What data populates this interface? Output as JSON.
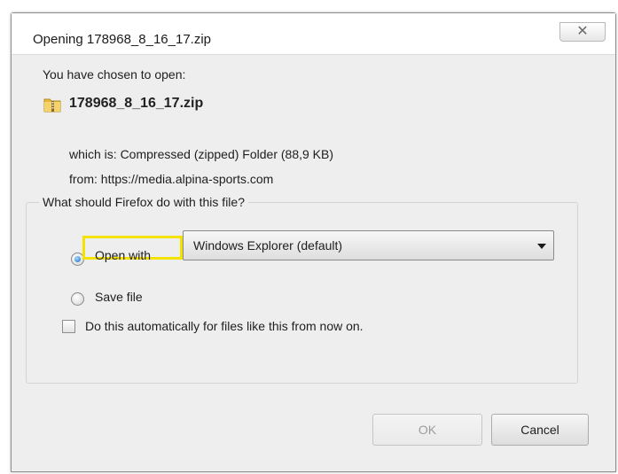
{
  "window": {
    "title": "Opening 178968_8_16_17.zip",
    "close_glyph": "✕"
  },
  "intro": "You have chosen to open:",
  "file": {
    "name": "178968_8_16_17.zip",
    "icon": "zip-folder-icon",
    "type_line": "which is: Compressed (zipped) Folder (88,9 KB)",
    "from_line": "from: https://media.alpina-sports.com"
  },
  "action_group": {
    "legend": "What should Firefox do with this file?",
    "open_with": {
      "label": "Open with",
      "selected": true
    },
    "app_select": {
      "value": "Windows Explorer (default)"
    },
    "save_file": {
      "label": "Save file",
      "selected": false
    },
    "auto_checkbox": {
      "label": "Do this automatically for files like this from now on.",
      "checked": false
    }
  },
  "buttons": {
    "ok": "OK",
    "cancel": "Cancel"
  },
  "colors": {
    "highlight_box": "#f4e300",
    "dialog_bg": "#eeeeee"
  }
}
